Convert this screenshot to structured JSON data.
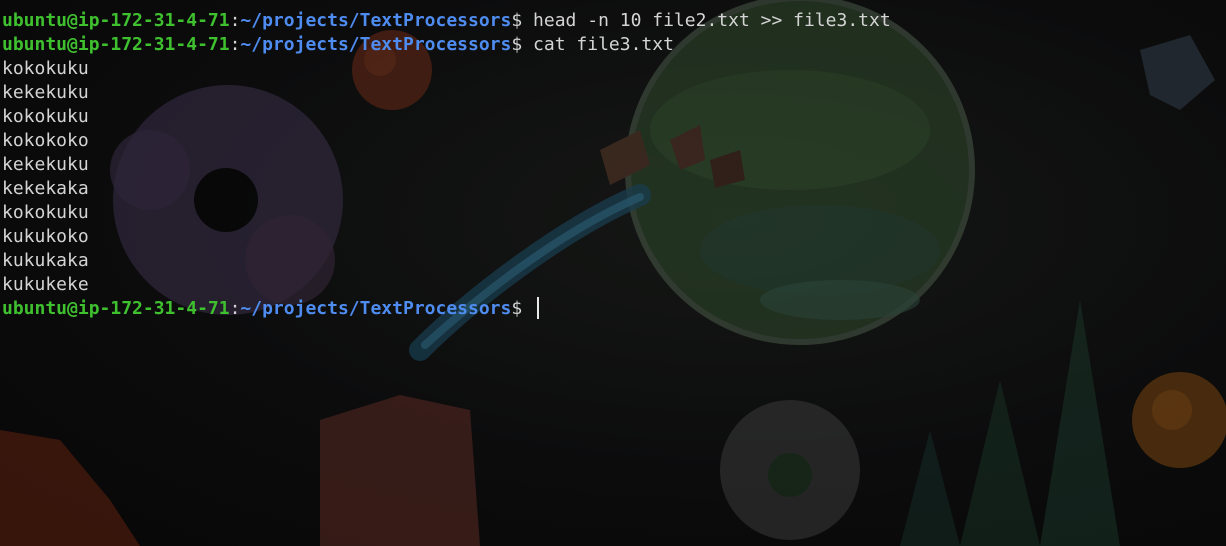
{
  "prompt": {
    "user_host": "ubuntu@ip-172-31-4-71",
    "separator": ":",
    "path": "~/projects/TextProcessors",
    "symbol": "$ "
  },
  "lines": [
    {
      "type": "command",
      "command": "head -n 10 file2.txt >> file3.txt"
    },
    {
      "type": "command",
      "command": "cat file3.txt"
    },
    {
      "type": "output",
      "text": "kokokuku"
    },
    {
      "type": "output",
      "text": "kekekuku"
    },
    {
      "type": "output",
      "text": "kokokuku"
    },
    {
      "type": "output",
      "text": "kokokoko"
    },
    {
      "type": "output",
      "text": "kekekuku"
    },
    {
      "type": "output",
      "text": "kekekaka"
    },
    {
      "type": "output",
      "text": "kokokuku"
    },
    {
      "type": "output",
      "text": "kukukoko"
    },
    {
      "type": "output",
      "text": "kukukaka"
    },
    {
      "type": "output",
      "text": "kukukeke"
    },
    {
      "type": "command",
      "command": "",
      "cursor": true
    }
  ],
  "colors": {
    "user_host": "#3fc02f",
    "path": "#4f8cf0",
    "text": "#d4d4d4",
    "background": "#0b0b0c"
  },
  "wallpaper": {
    "theme": "space-cartoon",
    "elements": [
      "planet-icon",
      "asteroid-icon",
      "comet-icon",
      "spaceship-icon",
      "moon-icon"
    ]
  }
}
